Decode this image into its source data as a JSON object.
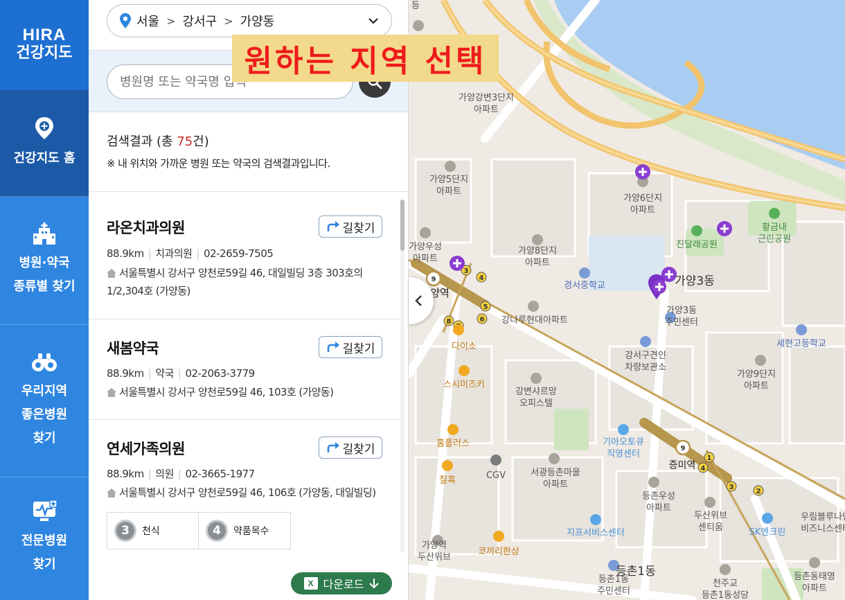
{
  "nav": {
    "logo_top": "HIRA",
    "logo_bottom": "건강지도",
    "items": [
      {
        "label": "건강지도 홈"
      },
      {
        "label": "병원·약국\n종류별 찾기"
      },
      {
        "label": "우리지역\n좋은병원\n찾기"
      },
      {
        "label": "전문병원\n찾기"
      }
    ]
  },
  "region": {
    "city": "서울",
    "district": "강서구",
    "dong": "가양동"
  },
  "search": {
    "placeholder": "병원명 또는 약국명 입력"
  },
  "results": {
    "prefix": "검색결과 (총 ",
    "count": "75",
    "suffix": "건)",
    "note": "※ 내 위치와 가까운 병원 또는 약국의 검색결과입니다."
  },
  "route_label": "길찾기",
  "cards": [
    {
      "name": "라온치과의원",
      "distance": "88.9km",
      "type": "치과의원",
      "phone": "02-2659-7505",
      "address": "서울특별시 강서구 양천로59길 46, 대일빌딩 3층 303호의1/2,304호 (가양동)"
    },
    {
      "name": "새봄약국",
      "distance": "88.9km",
      "type": "약국",
      "phone": "02-2063-3779",
      "address": "서울특별시 강서구 양천로59길 46, 103호 (가양동)"
    },
    {
      "name": "연세가족의원",
      "distance": "88.9km",
      "type": "의원",
      "phone": "02-3665-1977",
      "address": "서울특별시 강서구 양천로59길 46, 106호 (가양동, 대일빌딩)"
    }
  ],
  "badges": [
    {
      "num": "3",
      "label": "천식"
    },
    {
      "num": "4",
      "label": "약품목수"
    }
  ],
  "download_label": "다운로드",
  "overlay_text": "원하는 지역 선택",
  "map_labels": {
    "gayang_gangbyeon3": "가양강변3단지",
    "gayang5": "가양5단지",
    "gayang6": "가양6단지",
    "gayang8": "가양8단지",
    "gayang9": "가양9단지",
    "gayang_woosung": "가양우성",
    "apt": "아파트",
    "hwanggeumnae": "황금내",
    "neighborhood_park": "근린공원",
    "jindallae_park": "진달래공원",
    "gayang3dong": "가양3동",
    "gayang3dong_center": "가양3동",
    "community_center": "주민센터",
    "gyeongseo_ms": "경서중학교",
    "gangnaru": "강나루현대아파트",
    "sehyeon_hs": "세현고등학교",
    "gangseo_parking1": "강서구견인",
    "gangseo_parking2": "차량보관소",
    "daiso": "다이소",
    "sushi": "스시미즈키",
    "gangbyeon_sharp1": "강변샤르망",
    "gangbyeon_sharp2": "오피스텔",
    "homeplus": "홈플러스",
    "kia1": "기아오토큐",
    "kia2": "직영센터",
    "jeungmi": "증미역",
    "chilheuk": "칠흑",
    "cgv": "CGV",
    "seogwang1": "서광등촌마을",
    "woosung_dc": "등촌우성",
    "doosan_we_center1": "두산위브",
    "doosan_we_center2": "센티움",
    "woorim1": "우림블루나인",
    "woorim2": "비즈니스센터",
    "jifeu": "지프서비스센터",
    "sk": "SK엔크린",
    "gayang_station_small": "가양역",
    "doosan_we": "두산위브",
    "kokkiri": "코끼리한상",
    "deungchon1dong": "등촌1동",
    "deungchon1_center": "등촌1동",
    "cheonjugyo1": "천주교",
    "cheonjugyo2": "등촌1동성당",
    "deungchon_taeyoung": "등촌동태영",
    "yangyeok": "양역",
    "dong_top": "등"
  }
}
